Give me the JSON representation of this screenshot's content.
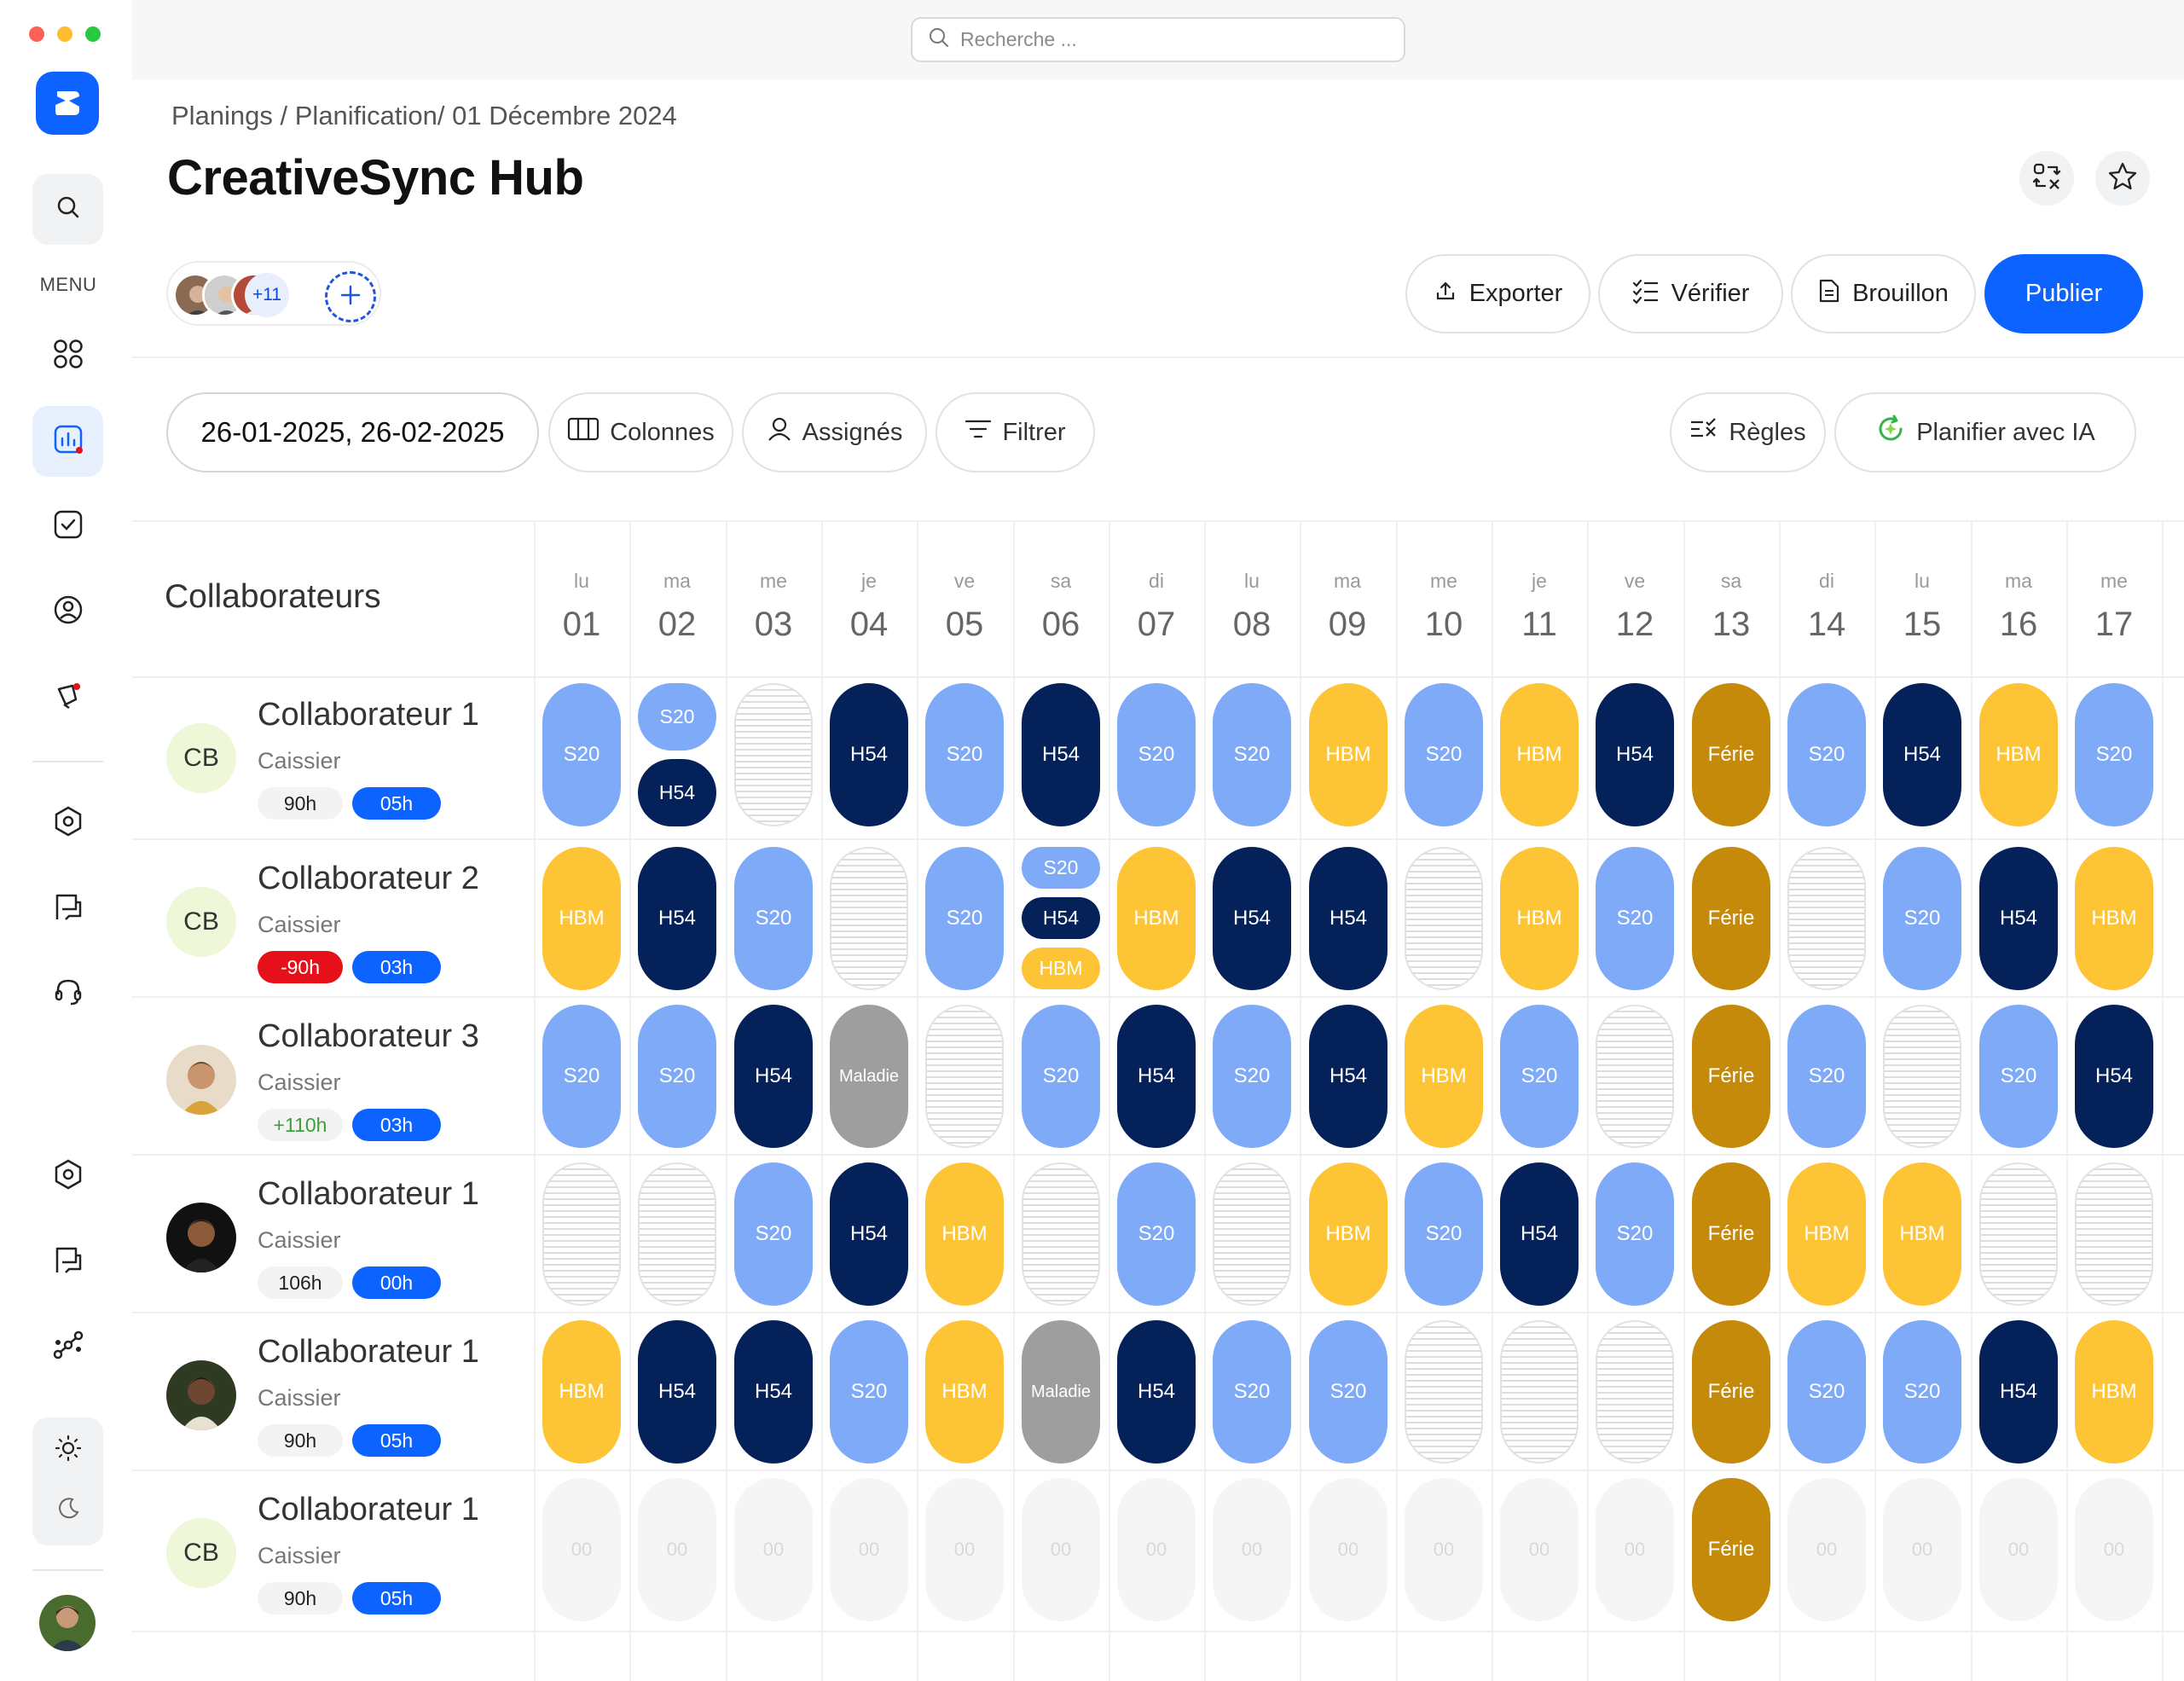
{
  "search": {
    "placeholder": "Recherche ..."
  },
  "sidebar": {
    "menu_label": "MENU",
    "icons": [
      "logo-icon",
      "search-icon",
      "dashboard-icon",
      "analytics-icon",
      "tasks-icon",
      "user-icon",
      "notifications-icon",
      "settings-icon",
      "messages-icon",
      "support-icon",
      "settings-icon",
      "messages-icon",
      "workflow-icon",
      "sun-icon",
      "moon-icon"
    ]
  },
  "breadcrumb": "Planings / Planification/ 01 Décembre 2024",
  "title": "CreativeSync Hub",
  "team": {
    "extra_count": "+11"
  },
  "actions": {
    "export": "Exporter",
    "verify": "Vérifier",
    "draft": "Brouillon",
    "publish": "Publier"
  },
  "filters": {
    "date_range": "26-01-2025, 26-02-2025",
    "columns": "Colonnes",
    "assigned": "Assignés",
    "filter": "Filtrer",
    "rules": "Règles",
    "ai_plan": "Planifier avec IA"
  },
  "colors": {
    "primary": "#0d63ff",
    "s20": "#7eaaf8",
    "h54": "#052159",
    "hbm": "#fdc436",
    "ferie": "#c68a0b",
    "maladie": "#9e9e9e",
    "negative": "#e5101a",
    "positive": "#3aa03a"
  },
  "schedule": {
    "collaborators_header": "Collaborateurs",
    "days": [
      {
        "name": "lu",
        "num": "01"
      },
      {
        "name": "ma",
        "num": "02"
      },
      {
        "name": "me",
        "num": "03"
      },
      {
        "name": "je",
        "num": "04"
      },
      {
        "name": "ve",
        "num": "05"
      },
      {
        "name": "sa",
        "num": "06"
      },
      {
        "name": "di",
        "num": "07"
      },
      {
        "name": "lu",
        "num": "08"
      },
      {
        "name": "ma",
        "num": "09"
      },
      {
        "name": "me",
        "num": "10"
      },
      {
        "name": "je",
        "num": "11"
      },
      {
        "name": "ve",
        "num": "12"
      },
      {
        "name": "sa",
        "num": "13"
      },
      {
        "name": "di",
        "num": "14"
      },
      {
        "name": "lu",
        "num": "15"
      },
      {
        "name": "ma",
        "num": "16"
      },
      {
        "name": "me",
        "num": "17"
      }
    ],
    "rows": [
      {
        "name": "Collaborateur 1",
        "role": "Caissier",
        "initials": "CB",
        "hours": "90h",
        "hours_state": "neutral",
        "extra": "05h",
        "cells": [
          [
            "S20"
          ],
          [
            "S20",
            "H54"
          ],
          [
            ""
          ],
          [
            "H54"
          ],
          [
            "S20"
          ],
          [
            "H54"
          ],
          [
            "S20"
          ],
          [
            "S20"
          ],
          [
            "HBM"
          ],
          [
            "S20"
          ],
          [
            "HBM"
          ],
          [
            "H54"
          ],
          [
            "Férie"
          ],
          [
            "S20"
          ],
          [
            "H54"
          ],
          [
            "HBM"
          ],
          [
            "S20"
          ]
        ]
      },
      {
        "name": "Collaborateur 2",
        "role": "Caissier",
        "initials": "CB",
        "hours": "-90h",
        "hours_state": "negative",
        "extra": "03h",
        "cells": [
          [
            "HBM"
          ],
          [
            "H54"
          ],
          [
            "S20"
          ],
          [
            ""
          ],
          [
            "S20"
          ],
          [
            "S20",
            "H54",
            "HBM"
          ],
          [
            "HBM"
          ],
          [
            "H54"
          ],
          [
            "H54"
          ],
          [
            ""
          ],
          [
            "HBM"
          ],
          [
            "S20"
          ],
          [
            "Férie"
          ],
          [
            ""
          ],
          [
            "S20"
          ],
          [
            "H54"
          ],
          [
            "HBM"
          ]
        ]
      },
      {
        "name": "Collaborateur 3",
        "role": "Caissier",
        "initials": "",
        "hours": "+110h",
        "hours_state": "positive",
        "extra": "03h",
        "cells": [
          [
            "S20"
          ],
          [
            "S20"
          ],
          [
            "H54"
          ],
          [
            "Maladie"
          ],
          [
            ""
          ],
          [
            "S20"
          ],
          [
            "H54"
          ],
          [
            "S20"
          ],
          [
            "H54"
          ],
          [
            "HBM"
          ],
          [
            "S20"
          ],
          [
            ""
          ],
          [
            "Férie"
          ],
          [
            "S20"
          ],
          [
            ""
          ],
          [
            "S20"
          ],
          [
            "H54"
          ]
        ]
      },
      {
        "name": "Collaborateur 1",
        "role": "Caissier",
        "initials": "",
        "hours": "106h",
        "hours_state": "neutral",
        "extra": "00h",
        "cells": [
          [
            ""
          ],
          [
            ""
          ],
          [
            "S20"
          ],
          [
            "H54"
          ],
          [
            "HBM"
          ],
          [
            ""
          ],
          [
            "S20"
          ],
          [
            ""
          ],
          [
            "HBM"
          ],
          [
            "S20"
          ],
          [
            "H54"
          ],
          [
            "S20"
          ],
          [
            "Férie"
          ],
          [
            "HBM"
          ],
          [
            "HBM"
          ],
          [
            ""
          ],
          [
            ""
          ]
        ]
      },
      {
        "name": "Collaborateur 1",
        "role": "Caissier",
        "initials": "",
        "hours": "90h",
        "hours_state": "neutral",
        "extra": "05h",
        "cells": [
          [
            "HBM"
          ],
          [
            "H54"
          ],
          [
            "H54"
          ],
          [
            "S20"
          ],
          [
            "HBM"
          ],
          [
            "Maladie"
          ],
          [
            "H54"
          ],
          [
            "S20"
          ],
          [
            "S20"
          ],
          [
            ""
          ],
          [
            ""
          ],
          [
            ""
          ],
          [
            "Férie"
          ],
          [
            "S20"
          ],
          [
            "S20"
          ],
          [
            "H54"
          ],
          [
            "HBM"
          ]
        ]
      },
      {
        "name": "Collaborateur 1",
        "role": "Caissier",
        "initials": "CB",
        "hours": "90h",
        "hours_state": "neutral",
        "extra": "05h",
        "cells": [
          [
            "00"
          ],
          [
            "00"
          ],
          [
            "00"
          ],
          [
            "00"
          ],
          [
            "00"
          ],
          [
            "00"
          ],
          [
            "00"
          ],
          [
            "00"
          ],
          [
            "00"
          ],
          [
            "00"
          ],
          [
            "00"
          ],
          [
            "00"
          ],
          [
            "Férie"
          ],
          [
            "00"
          ],
          [
            "00"
          ],
          [
            "00"
          ],
          [
            "00"
          ]
        ]
      }
    ]
  }
}
